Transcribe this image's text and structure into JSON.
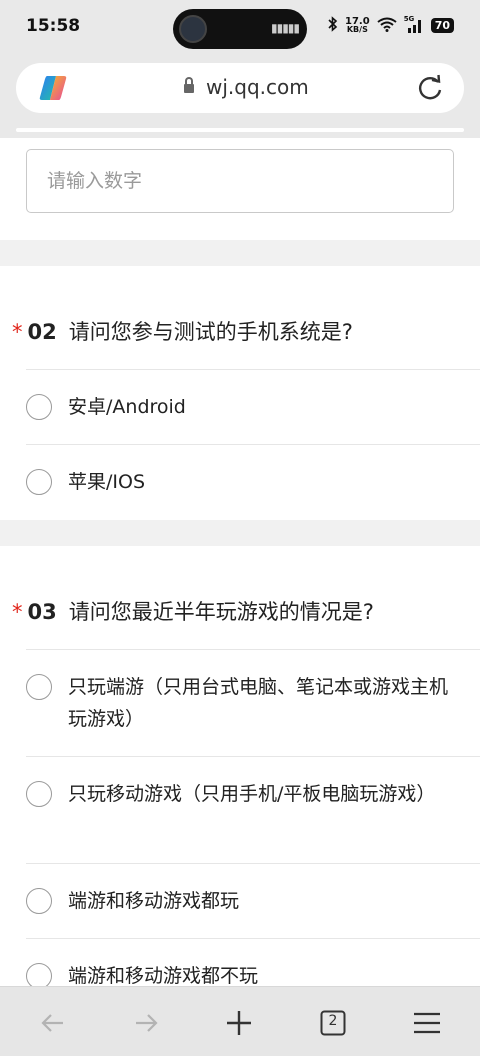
{
  "status_bar": {
    "time": "15:58",
    "speed_value": "17.0",
    "speed_unit": "KB/S",
    "network": "5G",
    "battery": "70"
  },
  "browser": {
    "url": "wj.qq.com",
    "tab_count": "2"
  },
  "form": {
    "number_input": {
      "placeholder": "请输入数字",
      "value": ""
    },
    "q2": {
      "required_mark": "*",
      "number": "02",
      "title": "请问您参与测试的手机系统是?",
      "options": [
        "安卓/Android",
        "苹果/IOS"
      ]
    },
    "q3": {
      "required_mark": "*",
      "number": "03",
      "title": "请问您最近半年玩游戏的情况是?",
      "options": [
        "只玩端游（只用台式电脑、笔记本或游戏主机玩游戏）",
        "只玩移动游戏（只用手机/平板电脑玩游戏）",
        "端游和移动游戏都玩",
        "端游和移动游戏都不玩"
      ]
    }
  },
  "colors": {
    "required": "#e1251b",
    "background": "#f1f1f1",
    "card": "#ffffff"
  }
}
